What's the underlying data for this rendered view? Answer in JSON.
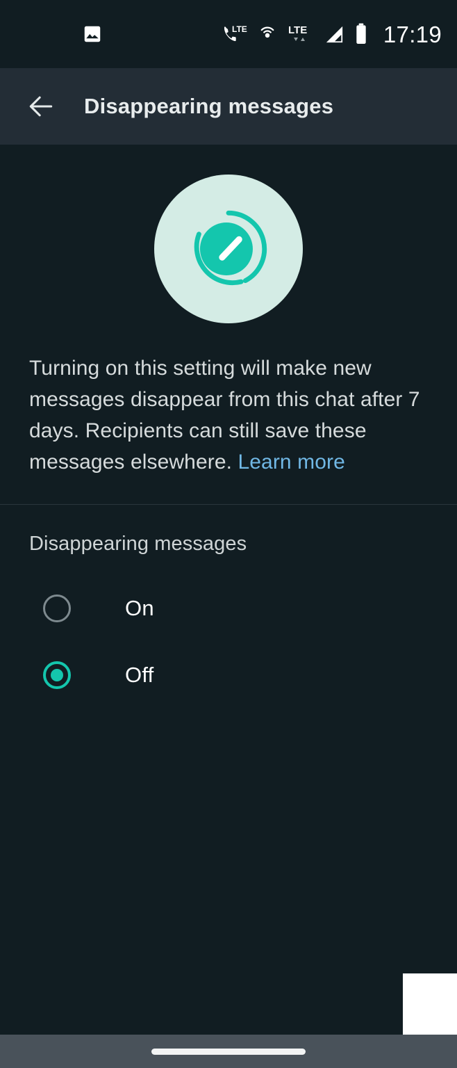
{
  "status_bar": {
    "time": "17:19",
    "icons": [
      {
        "name": "image-icon",
        "label": "photo"
      },
      {
        "name": "volte-phone-icon",
        "label": "LTE"
      },
      {
        "name": "hotspot-icon",
        "label": "hotspot"
      },
      {
        "name": "lte-data-icon",
        "label": "LTE"
      },
      {
        "name": "signal-bars-icon",
        "label": "signal"
      },
      {
        "name": "battery-icon",
        "label": "battery"
      }
    ]
  },
  "app_bar": {
    "back_label": "←",
    "title": "Disappearing messages"
  },
  "hero": {
    "icon_name": "disappearing-timer-icon",
    "circle_color": "#d4ece5",
    "accent_color": "#14c6ad"
  },
  "description": {
    "text": "Turning on this setting will make new messages disappear from this chat after 7 days. Recipients can still save these messages elsewhere. ",
    "link_label": "Learn more",
    "link_color": "#71b8e5"
  },
  "section": {
    "header": "Disappearing messages",
    "options": [
      {
        "label": "On",
        "selected": false
      },
      {
        "label": "Off",
        "selected": true
      }
    ]
  },
  "nav_bar": {
    "gesture_pill": "home-indicator"
  },
  "colors": {
    "background": "#111d22",
    "app_bar": "#232d36",
    "accent": "#14c6ad",
    "link": "#71b8e5",
    "divider": "#2a353c",
    "nav_bar": "#49525a"
  }
}
